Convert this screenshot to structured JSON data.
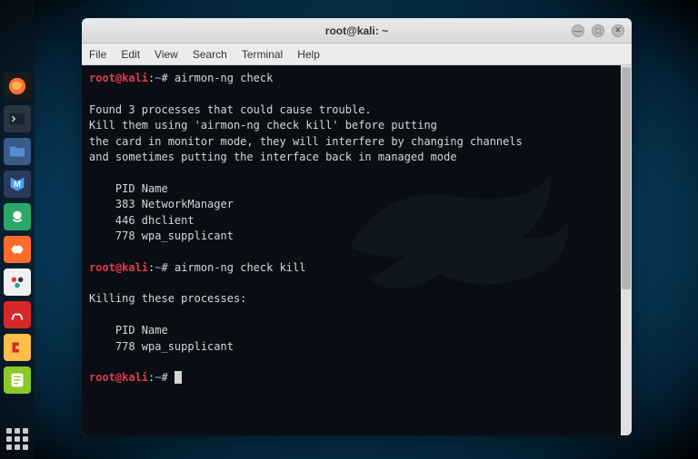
{
  "window": {
    "title": "root@kali: ~",
    "minimize": "—",
    "maximize": "□",
    "close": "✕"
  },
  "menubar": {
    "file": "File",
    "edit": "Edit",
    "view": "View",
    "search": "Search",
    "terminal": "Terminal",
    "help": "Help"
  },
  "terminal": {
    "prompt_user": "root@kali",
    "prompt_path": "~",
    "prompt_hash": "#",
    "cmd1": "airmon-ng check",
    "out1_l1": "Found 3 processes that could cause trouble.",
    "out1_l2": "Kill them using 'airmon-ng check kill' before putting",
    "out1_l3": "the card in monitor mode, they will interfere by changing channels",
    "out1_l4": "and sometimes putting the interface back in managed mode",
    "out1_hdr": "    PID Name",
    "out1_p1": "    383 NetworkManager",
    "out1_p2": "    446 dhclient",
    "out1_p3": "    778 wpa_supplicant",
    "cmd2": "airmon-ng check kill",
    "out2_l1": "Killing these processes:",
    "out2_hdr": "    PID Name",
    "out2_p1": "    778 wpa_supplicant"
  }
}
